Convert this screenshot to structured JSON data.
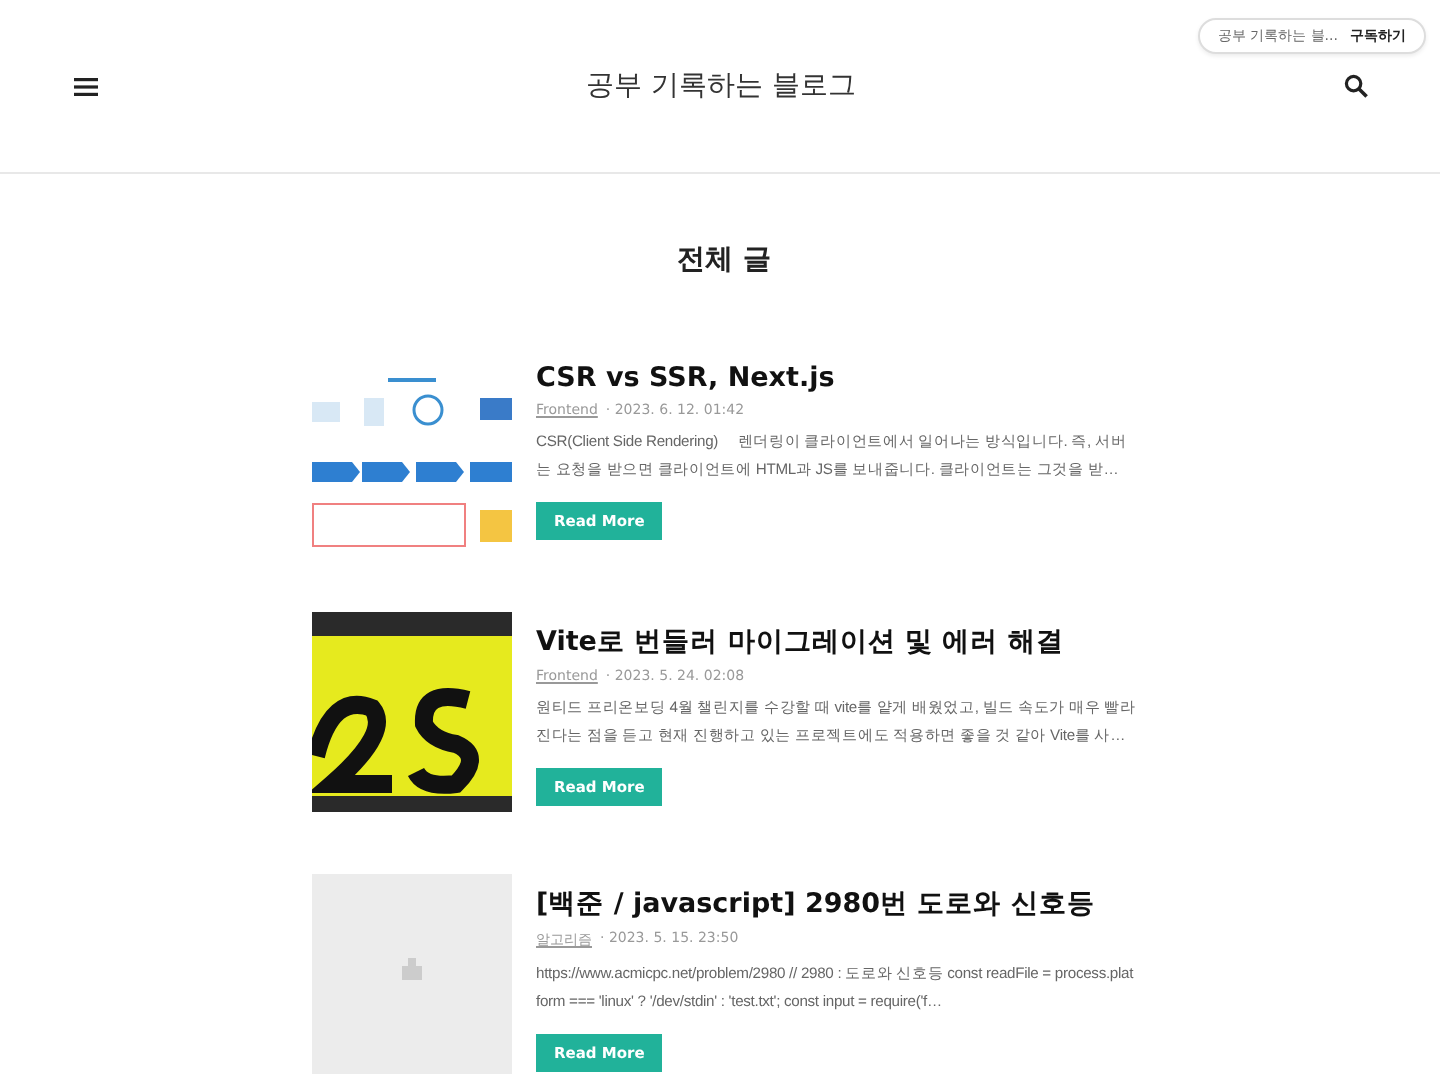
{
  "header": {
    "title": "공부 기록하는 블로그",
    "subscribe": {
      "blog_name": "공부 기록하는 블...",
      "button": "구독하기"
    }
  },
  "page_title": "전체 글",
  "posts": [
    {
      "title": "CSR vs SSR, Next.js",
      "category": "Frontend",
      "date": "· 2023. 6. 12. 01:42",
      "excerpt": "CSR(Client Side Rendering)  　렌더링이 클라이언트에서 일어나는 방식입니다. 즉, 서버는 요청을 받으면 클라이언트에 HTML과 JS를 보내줍니다. 클라이언트는 그것을 받…",
      "button": "Read More"
    },
    {
      "title": "Vite로 번들러 마이그레이션 및 에러 해결",
      "category": "Frontend",
      "date": "· 2023. 5. 24. 02:08",
      "excerpt": "원티드 프리온보딩 4월 챌린지를 수강할 때 vite를 얕게 배웠었고, 빌드 속도가 매우 빨라진다는 점을 듣고 현재 진행하고 있는 프로젝트에도 적용하면 좋을 것 같아 Vite를 사…",
      "button": "Read More"
    },
    {
      "thumbnail": {
        "kind": "placeholder"
      },
      "title": "[백준 / javascript] 2980번 도로와 신호등",
      "category": "알고리즘",
      "date": "· 2023. 5. 15. 23:50",
      "excerpt": "https://www.acmicpc.net/problem/2980 // 2980 : 도로와 신호등 const readFile = process.platform === 'linux' ? '/dev/stdin' : 'test.txt'; const input = require('f…",
      "button": "Read More"
    }
  ]
}
